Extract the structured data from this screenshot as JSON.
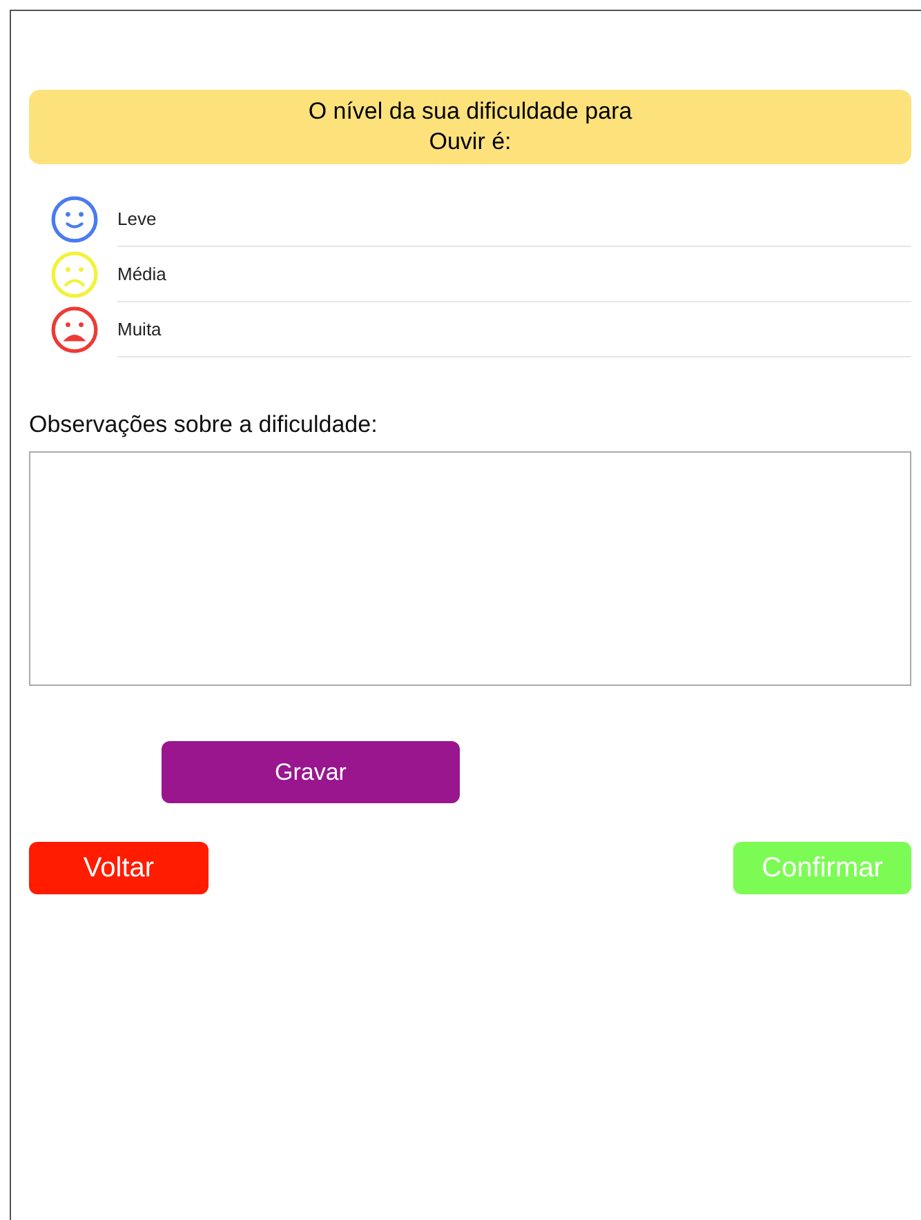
{
  "header": {
    "lines": [
      "O nível da sua dificuldade para",
      "Ouvir é:"
    ]
  },
  "options": [
    {
      "label": "Leve",
      "kind": "happy",
      "color": "#4a7cf0"
    },
    {
      "label": "Média",
      "kind": "sad",
      "color": "#f2f23a"
    },
    {
      "label": "Muita",
      "kind": "upset",
      "color": "#ee3a35"
    }
  ],
  "notes": {
    "label": "Observações sobre a dificuldade:"
  },
  "record_button": "Gravar",
  "back_button": "Voltar",
  "confirm_button": "Confirmar"
}
